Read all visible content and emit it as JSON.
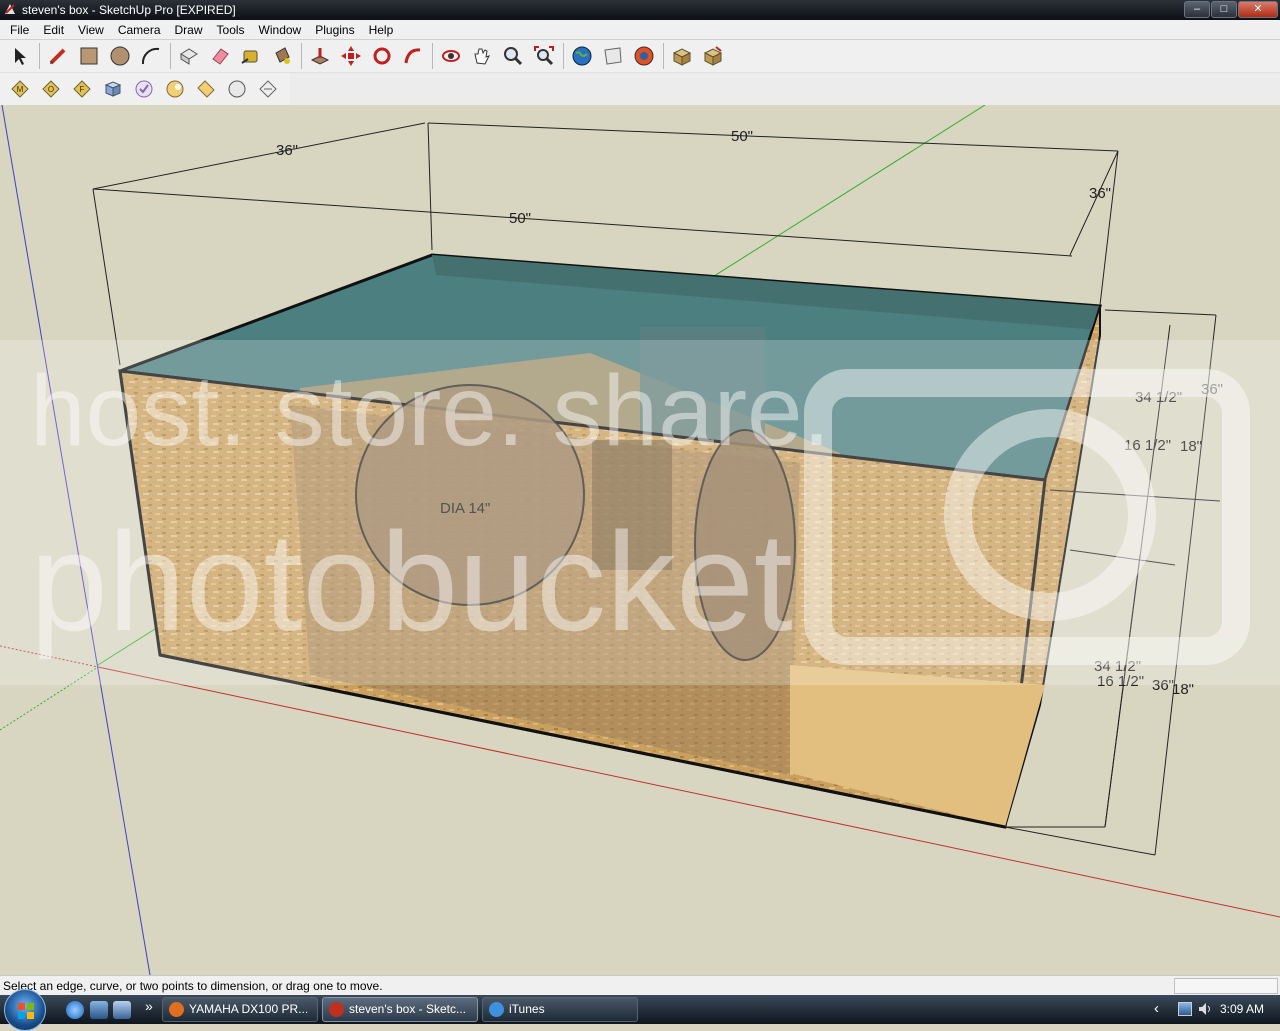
{
  "window": {
    "title": "steven's box - SketchUp Pro [EXPIRED]",
    "controls": {
      "minimize": "–",
      "maximize": "□",
      "close": "✕"
    }
  },
  "menu": [
    "File",
    "Edit",
    "View",
    "Camera",
    "Draw",
    "Tools",
    "Window",
    "Plugins",
    "Help"
  ],
  "toolbar1": [
    {
      "name": "select-tool",
      "icon": "arrow-icon"
    },
    {
      "name": "pencil-tool",
      "icon": "pencil-icon"
    },
    {
      "name": "rectangle-tool",
      "icon": "rectangle-icon"
    },
    {
      "name": "circle-tool",
      "icon": "circle-icon"
    },
    {
      "name": "arc-tool",
      "icon": "arc-icon"
    },
    {
      "name": "make-component-tool",
      "icon": "component-icon"
    },
    {
      "name": "eraser-tool",
      "icon": "eraser-icon"
    },
    {
      "name": "tape-measure-tool",
      "icon": "tape-icon"
    },
    {
      "name": "paint-bucket-tool",
      "icon": "bucket-icon"
    },
    {
      "name": "push-pull-tool",
      "icon": "pushpull-icon"
    },
    {
      "name": "move-tool",
      "icon": "move-icon"
    },
    {
      "name": "rotate-tool",
      "icon": "rotate-icon"
    },
    {
      "name": "follow-me-tool",
      "icon": "followme-icon"
    },
    {
      "name": "orbit-tool",
      "icon": "orbit-icon"
    },
    {
      "name": "pan-tool",
      "icon": "hand-icon"
    },
    {
      "name": "zoom-tool",
      "icon": "zoom-icon"
    },
    {
      "name": "zoom-extents-tool",
      "icon": "zoom-extents-icon"
    },
    {
      "name": "google-earth-tool",
      "icon": "earth-icon"
    },
    {
      "name": "get-models-tool",
      "icon": "models-icon"
    },
    {
      "name": "share-model-tool",
      "icon": "share-icon"
    },
    {
      "name": "component-get-tool",
      "icon": "box-icon"
    },
    {
      "name": "component-share-tool",
      "icon": "box-share-icon"
    }
  ],
  "toolbar2": [
    {
      "name": "tag-m-tool",
      "icon": "tag-icon"
    },
    {
      "name": "tag-o-tool",
      "icon": "tag-icon"
    },
    {
      "name": "tag-f-tool",
      "icon": "tag-icon"
    },
    {
      "name": "cube-tool",
      "icon": "cube-icon"
    },
    {
      "name": "check-tool",
      "icon": "check-icon"
    },
    {
      "name": "plugin-a-tool",
      "icon": "plugin-icon"
    },
    {
      "name": "plugin-b-tool",
      "icon": "plugin-icon"
    },
    {
      "name": "sphere-tool",
      "icon": "sphere-icon"
    },
    {
      "name": "plane-tool",
      "icon": "plane-icon"
    }
  ],
  "dimensions": {
    "top_back_left": "36\"",
    "top_back_width": "50\"",
    "top_front_width": "50\"",
    "right_depth": "36\"",
    "right_a": "34 1/2\"",
    "right_b": "16 1/2\"",
    "right_c": "36\"",
    "right_d": "18\"",
    "lower_a": "34 1/2\"",
    "lower_b": "16 1/2\"",
    "lower_c": "36\"",
    "lower_d": "18\"",
    "port": "DIA 14\""
  },
  "watermark": {
    "line1": "host. store. share.",
    "line2": "photobucket"
  },
  "status": {
    "text": "Select an edge, curve, or two points to dimension, or drag one to move.",
    "measurements": ""
  },
  "taskbar": {
    "items": [
      {
        "label": "YAMAHA DX100 PR...",
        "icon_color": "#e07020"
      },
      {
        "label": "steven's box - Sketc...",
        "icon_color": "#c03020"
      },
      {
        "label": "iTunes",
        "icon_color": "#4090e0"
      }
    ],
    "overflow_chevron": "»",
    "tray_chevron": "‹",
    "clock": "3:09 AM"
  }
}
